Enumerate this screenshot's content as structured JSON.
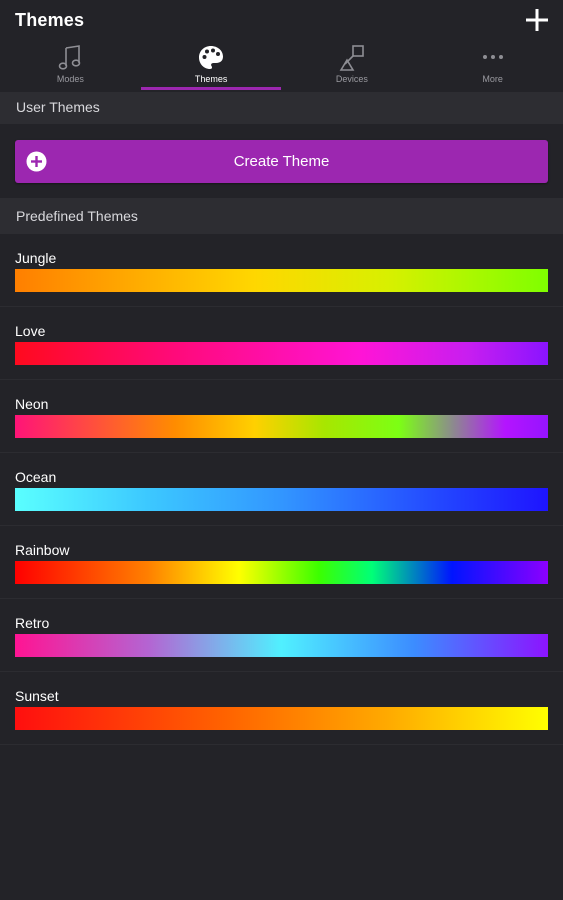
{
  "header": {
    "title": "Themes"
  },
  "tabs": [
    {
      "label": "Modes",
      "icon": "music-note-icon"
    },
    {
      "label": "Themes",
      "icon": "palette-icon"
    },
    {
      "label": "Devices",
      "icon": "devices-icon"
    },
    {
      "label": "More",
      "icon": "more-dots-icon"
    }
  ],
  "active_tab": "Themes",
  "user_themes": {
    "header": "User Themes",
    "create_label": "Create Theme"
  },
  "predefined": {
    "header": "Predefined Themes",
    "themes": [
      {
        "name": "Jungle"
      },
      {
        "name": "Love"
      },
      {
        "name": "Neon"
      },
      {
        "name": "Ocean"
      },
      {
        "name": "Rainbow"
      },
      {
        "name": "Retro"
      },
      {
        "name": "Sunset"
      }
    ]
  },
  "colors": {
    "accent": "#9c27b0",
    "background": "#232328",
    "section": "#2d2d32"
  }
}
